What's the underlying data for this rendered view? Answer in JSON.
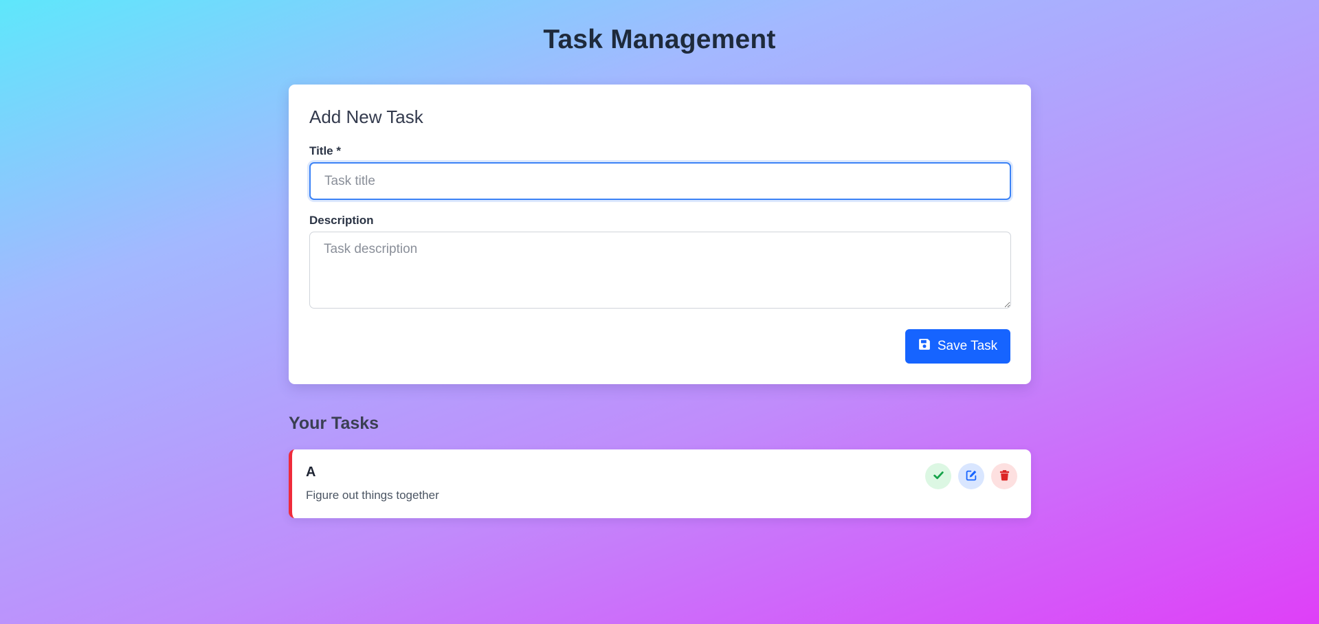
{
  "header": {
    "title": "Task Management"
  },
  "form": {
    "heading": "Add New Task",
    "title_label": "Title *",
    "title_placeholder": "Task title",
    "title_value": "",
    "description_label": "Description",
    "description_placeholder": "Task description",
    "description_value": "",
    "save_label": "Save Task",
    "save_icon": "floppy-disk-icon"
  },
  "tasks_section": {
    "heading": "Your Tasks",
    "items": [
      {
        "title": "A",
        "description": "Figure out things together",
        "priority_color": "#ef2b3a",
        "actions": [
          {
            "icon": "check-icon",
            "color": "#16a34a"
          },
          {
            "icon": "edit-icon",
            "color": "#1664ff"
          },
          {
            "icon": "trash-icon",
            "color": "#dc2626"
          }
        ]
      }
    ]
  },
  "colors": {
    "accent": "#1664ff",
    "focus_border": "#3b82f6",
    "background_gradient": [
      "#5ee7fb",
      "#a3b8ff",
      "#c08cfb",
      "#df3ff8"
    ]
  }
}
